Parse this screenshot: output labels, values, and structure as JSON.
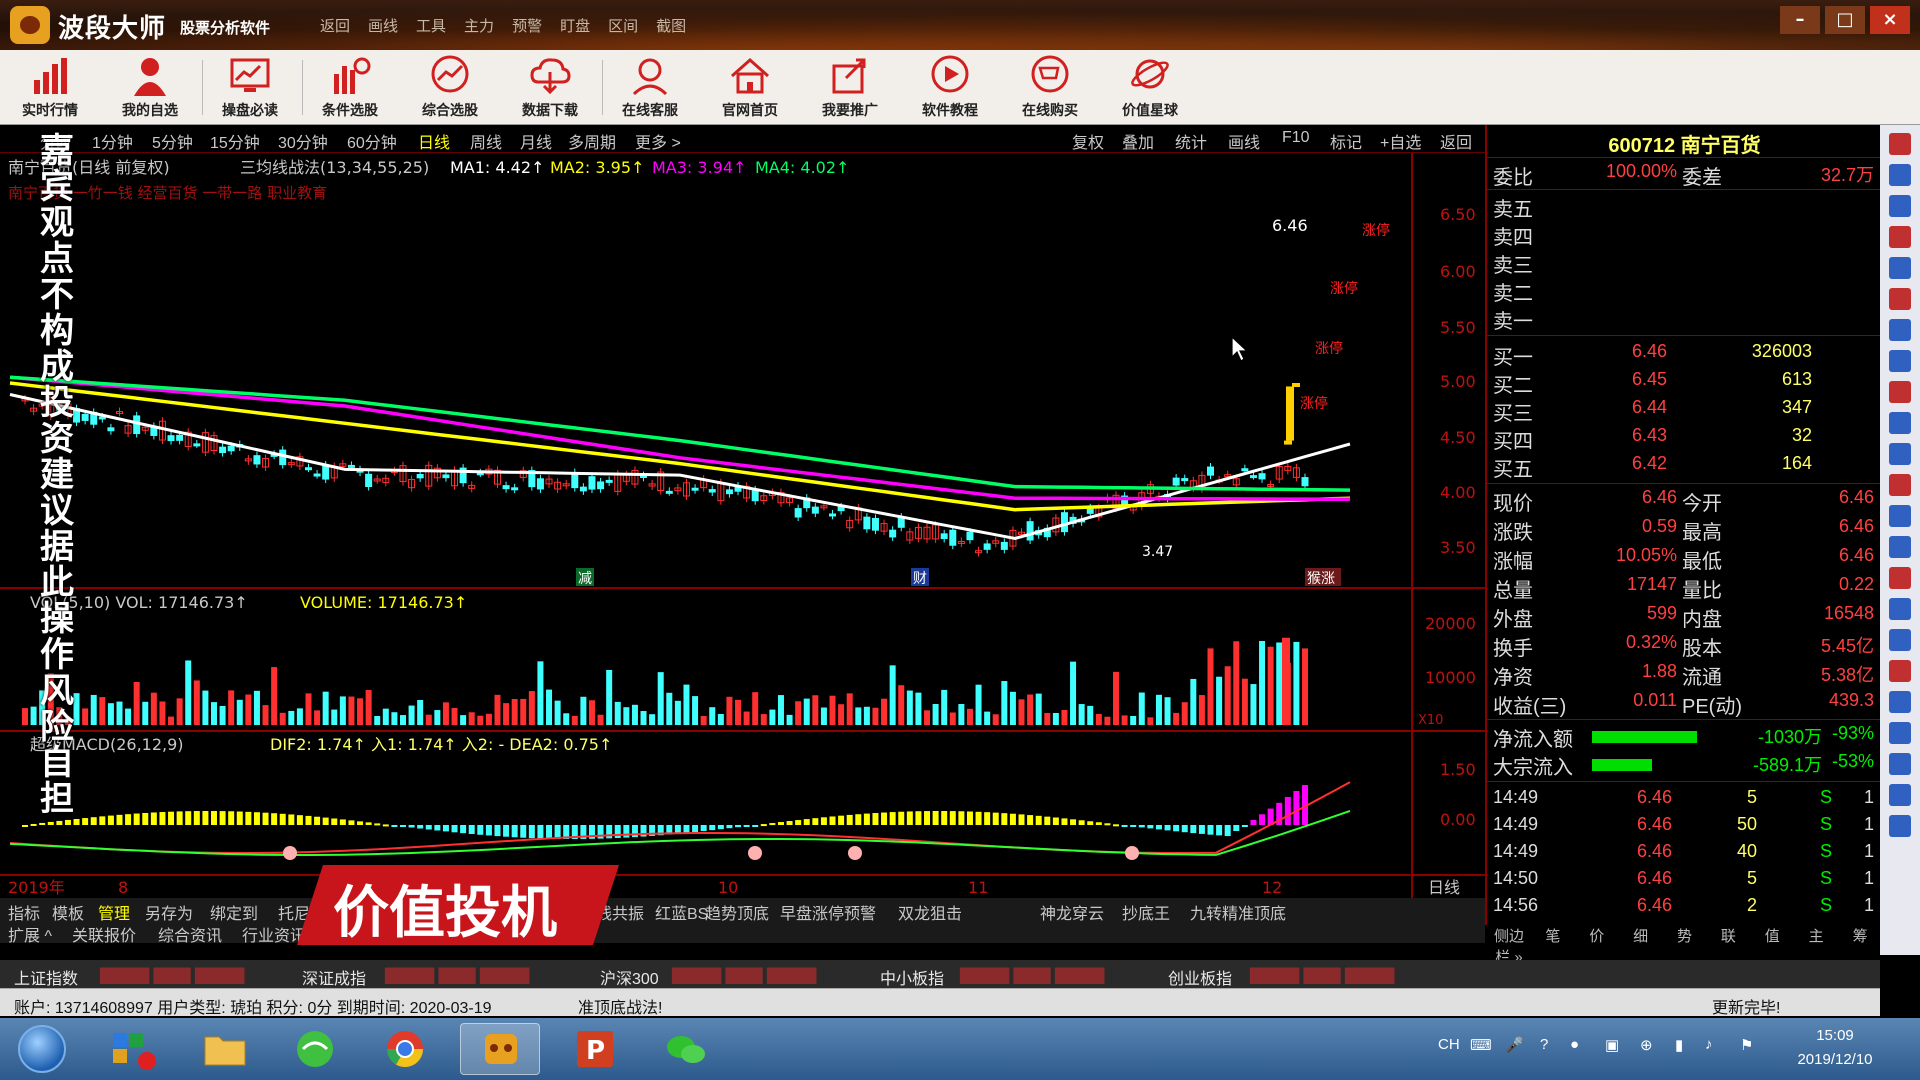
{
  "titlebar": {
    "brand": "波段大师",
    "brand_sub": "股票分析软件",
    "menu": [
      "返回",
      "画线",
      "工具",
      "主力",
      "预警",
      "盯盘",
      "区间",
      "截图"
    ]
  },
  "toolbar": {
    "items": [
      "实时行情",
      "我的自选",
      "操盘必读",
      "条件选股",
      "综合选股",
      "数据下载",
      "在线客服",
      "官网首页",
      "我要推广",
      "软件教程",
      "在线购买",
      "价值星球"
    ]
  },
  "periodbar": {
    "periods": [
      "分时",
      "1分钟",
      "5分钟",
      "15分钟",
      "30分钟",
      "60分钟",
      "日线",
      "周线",
      "月线",
      "多周期",
      "更多 >"
    ],
    "active": "日线",
    "right_buttons": [
      "复权",
      "叠加",
      "统计",
      "画线",
      "F10",
      "标记",
      "+自选",
      "返回"
    ]
  },
  "chart": {
    "header": "南宁百货(日线 前复权)",
    "indicator": "三均线战法(13,34,55,25)",
    "ma1": "MA1: 4.42↑",
    "ma2": "MA2: 3.95↑",
    "ma3": "MA3: 3.94↑",
    "ma4": "MA4: 4.02↑",
    "sub_header": "南宁百货  一竹一钱  经营百货  一带一路  职业教育",
    "price_label_high": "6.46",
    "price_label_low": "3.47",
    "markers": [
      "涨停",
      "涨停",
      "涨停",
      "涨停"
    ],
    "flags": [
      "减",
      "财",
      "猴涨"
    ],
    "price_axis": [
      "6.50",
      "6.00",
      "5.50",
      "5.00",
      "4.50",
      "4.00",
      "3.50"
    ],
    "vol_header": "VOL(5,10) VOL: 17146.73↑",
    "vol_value": "VOLUME: 17146.73↑",
    "vol_axis": [
      "20000",
      "10000"
    ],
    "vol_unit": "X10",
    "macd_header": "超级MACD(26,12,9)",
    "macd_values": "DIF2: 1.74↑  入1: 1.74↑  入2: -  DEA2: 0.75↑",
    "macd_axis": [
      "1.50",
      "0.00"
    ],
    "date_axis": [
      "2019年",
      "8",
      "10",
      "11",
      "12"
    ],
    "period_tag": "日线"
  },
  "chart_data": {
    "type": "line",
    "x": [
      "2019-08",
      "2019-09",
      "2019-10",
      "2019-11",
      "2019-12"
    ],
    "series": [
      {
        "name": "MA1",
        "values": [
          4.85,
          4.2,
          4.15,
          3.6,
          4.42
        ]
      },
      {
        "name": "MA2",
        "values": [
          4.95,
          4.6,
          4.25,
          3.85,
          3.95
        ]
      },
      {
        "name": "MA3",
        "values": [
          5.0,
          4.75,
          4.3,
          3.95,
          3.94
        ]
      },
      {
        "name": "MA4",
        "values": [
          5.0,
          4.8,
          4.45,
          4.05,
          4.02
        ]
      }
    ],
    "ylim": [
      3.3,
      6.6
    ]
  },
  "quote": {
    "code_name": "600712 南宁百货",
    "weibi_label": "委比",
    "weibi": "100.00%",
    "weicha_label": "委差",
    "weicha": "32.7万",
    "sell": [
      {
        "label": "卖五"
      },
      {
        "label": "卖四"
      },
      {
        "label": "卖三"
      },
      {
        "label": "卖二"
      },
      {
        "label": "卖一"
      }
    ],
    "buy": [
      {
        "label": "买一",
        "price": "6.46",
        "vol": "326003"
      },
      {
        "label": "买二",
        "price": "6.45",
        "vol": "613"
      },
      {
        "label": "买三",
        "price": "6.44",
        "vol": "347"
      },
      {
        "label": "买四",
        "price": "6.43",
        "vol": "32"
      },
      {
        "label": "买五",
        "price": "6.42",
        "vol": "164"
      }
    ],
    "stats": [
      {
        "l1": "现价",
        "v1": "6.46",
        "l2": "今开",
        "v2": "6.46"
      },
      {
        "l1": "涨跌",
        "v1": "0.59",
        "l2": "最高",
        "v2": "6.46"
      },
      {
        "l1": "涨幅",
        "v1": "10.05%",
        "l2": "最低",
        "v2": "6.46"
      },
      {
        "l1": "总量",
        "v1": "17147",
        "l2": "量比",
        "v2": "0.22"
      },
      {
        "l1": "外盘",
        "v1": "599",
        "l2": "内盘",
        "v2": "16548"
      },
      {
        "l1": "换手",
        "v1": "0.32%",
        "l2": "股本",
        "v2": "5.45亿"
      },
      {
        "l1": "净资",
        "v1": "1.88",
        "l2": "流通",
        "v2": "5.38亿"
      },
      {
        "l1": "收益(三)",
        "v1": "0.011",
        "l2": "PE(动)",
        "v2": "439.3"
      }
    ],
    "flow": [
      {
        "label": "净流入额",
        "value": "-1030万",
        "pct": "-93%"
      },
      {
        "label": "大宗流入",
        "value": "-589.1万",
        "pct": "-53%"
      }
    ],
    "ticks": [
      {
        "time": "14:49",
        "price": "6.46",
        "vol": "5",
        "side": "S",
        "n": "1"
      },
      {
        "time": "14:49",
        "price": "6.46",
        "vol": "50",
        "side": "S",
        "n": "1"
      },
      {
        "time": "14:49",
        "price": "6.46",
        "vol": "40",
        "side": "S",
        "n": "1"
      },
      {
        "time": "14:50",
        "price": "6.46",
        "vol": "5",
        "side": "S",
        "n": "1"
      },
      {
        "time": "14:56",
        "price": "6.46",
        "vol": "2",
        "side": "S",
        "n": "1"
      }
    ],
    "tabs": [
      "侧边栏 »",
      "笔",
      "价",
      "细",
      "势",
      "联",
      "值",
      "主",
      "筹"
    ]
  },
  "bottom_tabs": {
    "row1": [
      "指标",
      "模板",
      "管理",
      "另存为",
      "绑定到",
      "托尼通",
      "三线共振",
      "红蓝BS",
      "趋势顶底",
      "早盘涨停预警",
      "双龙狙击",
      "神龙穿云",
      "抄底王",
      "九转精准顶底"
    ],
    "row2": [
      "扩展 ^",
      "关联报价",
      "综合资讯",
      "行业资讯"
    ],
    "active": "管理"
  },
  "indexbar": {
    "items": [
      "上证指数",
      "深证成指",
      "沪深300",
      "中小板指",
      "创业板指"
    ]
  },
  "statusbar": {
    "account": "账户: 13714608997 用户类型: 琥珀 积分: 0分 到期时间: 2020-03-19",
    "tip": "准顶底战法!",
    "right": "更新完毕!"
  },
  "taskbar": {
    "tray_lang": "CH",
    "time": "15:09",
    "date": "2019/12/10"
  },
  "overlay": {
    "disclaimer": "嘉宾观点不构成投资建议 据此操作风险自担",
    "banner": "价值投机"
  },
  "colors": {
    "up": "#ff3030",
    "down": "#40ffff",
    "ma1": "#ffffff",
    "ma2": "#ffff00",
    "ma3": "#ff00ff",
    "ma4": "#00ff66"
  }
}
